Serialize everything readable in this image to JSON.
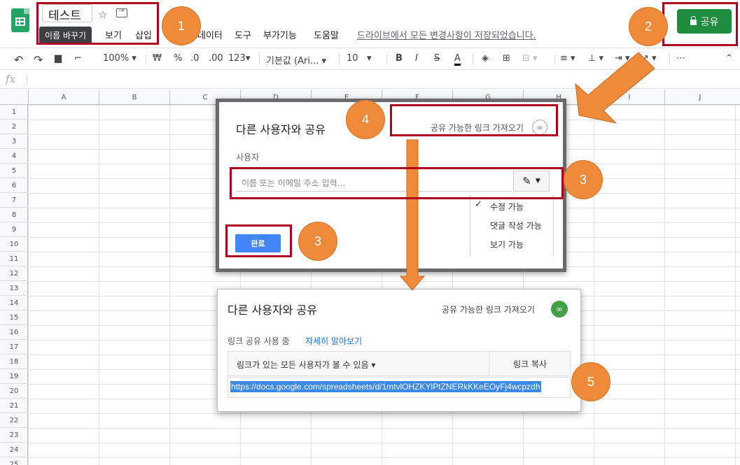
{
  "header": {
    "doc_title": "테스트",
    "tooltip": "이름 바꾸기",
    "menu": [
      "보기",
      "삽입",
      "데이터",
      "도구",
      "부가기능",
      "도움말"
    ],
    "save_status": "드라이브에서 모든 변경사항이 저장되었습니다.",
    "share_label": "공유"
  },
  "toolbar": {
    "zoom": "100%",
    "currency": "₩",
    "percent": "%",
    "decrease_decimal": ".0",
    "increase_decimal": ".00",
    "number_format": "123",
    "font": "기본값 (Ari...",
    "font_size": "10",
    "more": "⋯"
  },
  "formula": {
    "fx": "fx"
  },
  "grid": {
    "columns": [
      "A",
      "B",
      "C",
      "D",
      "E",
      "F",
      "G",
      "H",
      "I",
      "J"
    ],
    "rows": [
      "1",
      "2",
      "3",
      "4",
      "5",
      "6",
      "7",
      "8",
      "9",
      "10",
      "11",
      "12",
      "13",
      "14",
      "15",
      "16",
      "17",
      "18",
      "19",
      "20",
      "21",
      "22",
      "23",
      "24",
      "25"
    ]
  },
  "dialog1": {
    "title": "다른 사용자와 공유",
    "get_link": "공유 가능한 링크 가져오기",
    "users_label": "사용자",
    "input_placeholder": "이름 또는 이메일 주소 입력...",
    "permissions": [
      "수정 가능",
      "댓글 작성 가능",
      "보기 가능"
    ],
    "done_label": "완료"
  },
  "dialog2": {
    "title": "다른 사용자와 공유",
    "get_link": "공유 가능한 링크 가져오기",
    "link_status": "링크 공유 사용 중",
    "learn_more": "자세히 알아보기",
    "access_select": "링크가 있는 모든 사용자가 볼 수 있음",
    "copy_link": "링크 복사",
    "url": "https://docs.google.com/spreadsheets/d/1mtvlOHZKYlPtZNERkKKeEOyFj4wcpzdh"
  },
  "annotations": {
    "step1": "1",
    "step2": "2",
    "step3a": "3",
    "step3b": "3",
    "step4": "4",
    "step5": "5"
  },
  "colors": {
    "share_green": "#1e8e3e",
    "annotation_red": "#b00020",
    "annotation_orange": "#ee8a3a",
    "link_blue": "#1a73e8"
  }
}
